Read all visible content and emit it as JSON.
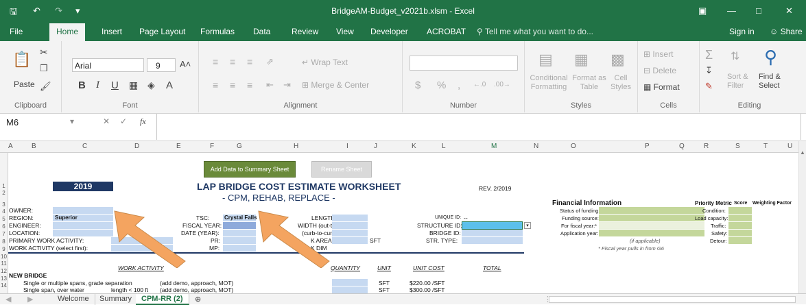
{
  "window": {
    "title": "BridgeAM-Budget_v2021b.xlsm - Excel",
    "save_icon": "save-icon",
    "undo_icon": "undo-icon",
    "redo_icon": "redo-icon"
  },
  "colors": {
    "excel_green": "#217346",
    "input_blue": "#c6d9f1",
    "green_cell": "#c4d79b",
    "arrow_orange": "#f4a460"
  },
  "ribbon_tabs": [
    "File",
    "Home",
    "Insert",
    "Page Layout",
    "Formulas",
    "Data",
    "Review",
    "View",
    "Developer",
    "ACROBAT"
  ],
  "tell_me": "Tell me what you want to do...",
  "sign_in": "Sign in",
  "share": "Share",
  "ribbon": {
    "paste": "Paste",
    "font_name": "Arial",
    "font_size": "9",
    "wrap_text": "Wrap Text",
    "merge_center": "Merge & Center",
    "conditional_formatting": "Conditional Formatting",
    "format_as_table": "Format as Table",
    "cell_styles": "Cell Styles",
    "insert": "Insert",
    "delete": "Delete",
    "format": "Format",
    "sort_filter": "Sort & Filter",
    "find_select": "Find & Select",
    "groups": [
      "Clipboard",
      "Font",
      "Alignment",
      "Number",
      "Styles",
      "Cells",
      "Editing"
    ]
  },
  "name_box": "M6",
  "fx": "fx",
  "columns": [
    "A",
    "B",
    "C",
    "D",
    "E",
    "F",
    "G",
    "H",
    "I",
    "J",
    "K",
    "L",
    "M",
    "N",
    "O",
    "P",
    "Q",
    "R",
    "S",
    "T",
    "U"
  ],
  "rows": [
    "1",
    "2",
    "3",
    "4",
    "5",
    "6",
    "7",
    "8",
    "9",
    "10",
    "11",
    "12",
    "13",
    "14"
  ],
  "buttons": {
    "add_data": "Add Data to Summary Sheet",
    "rename": "Rename Sheet"
  },
  "sheet": {
    "year": "2019",
    "title": "LAP BRIDGE COST ESTIMATE WORKSHEET",
    "subtitle": "- CPM, REHAB, REPLACE -",
    "rev": "REV. 2/2019",
    "owner": "OWNER:",
    "region": "REGION:",
    "region_value": "Superior",
    "engineer": "ENGINEER:",
    "location": "LOCATION:",
    "primary_activity": "PRIMARY WORK ACTIVITY:",
    "work_activity": "WORK ACTIVITY (select first):",
    "tsc": "TSC:",
    "tsc_value": "Crystal Falls",
    "fiscal_year": "FISCAL YEAR:",
    "date_year": "DATE (YEAR):",
    "pr": "PR:",
    "mp": "MP:",
    "length": "LENGTH",
    "width_out": "WIDTH (out-to-out)",
    "curb": "(curb-to-curb)",
    "area": "K AREA",
    "dim": "K DIM",
    "sft": "SFT",
    "unique_id": "UNIQUE ID:",
    "unique_id_value": "--",
    "structure_id": "STRUCTURE ID:",
    "bridge_id": "BRIDGE ID:",
    "str_type": "STR. TYPE:",
    "hdr_work_activity": "WORK ACTIVITY",
    "hdr_quantity": "QUANTITY",
    "hdr_unit": "UNIT",
    "hdr_unit_cost": "UNIT COST",
    "hdr_total": "TOTAL",
    "new_bridge": "NEW BRIDGE",
    "row13_desc": "Single or multiple spans, grade separation",
    "row13_note": "(add demo, approach, MOT)",
    "row13_unit": "SFT",
    "row13_cost": "$220.00 /SFT",
    "row14_desc": "Single span, over water",
    "row14_len": "length < 100 ft",
    "row14_note": "(add demo, approach, MOT)",
    "row14_unit": "SFT",
    "row14_cost": "$300.00 /SFT",
    "fin_title": "Financial Information",
    "fin_status": "Status of funding:",
    "fin_source": "Funding source:",
    "fin_fiscal": "For fiscal year:*",
    "fin_app": "Application year:",
    "fin_applicable": "(if applicable)",
    "fin_note": "* Fiscal year pulls in from G6",
    "prio_title": "Priority Metric",
    "prio_score": "Score",
    "prio_weight": "Weighting Factor",
    "prio_condition": "Condition:",
    "prio_load": "Load capacity:",
    "prio_traffic": "Traffic:",
    "prio_safety": "Safety:",
    "prio_detour": "Detour:"
  },
  "sheet_tabs": [
    "Welcome",
    "Summary",
    "CPM-RR (2)"
  ]
}
